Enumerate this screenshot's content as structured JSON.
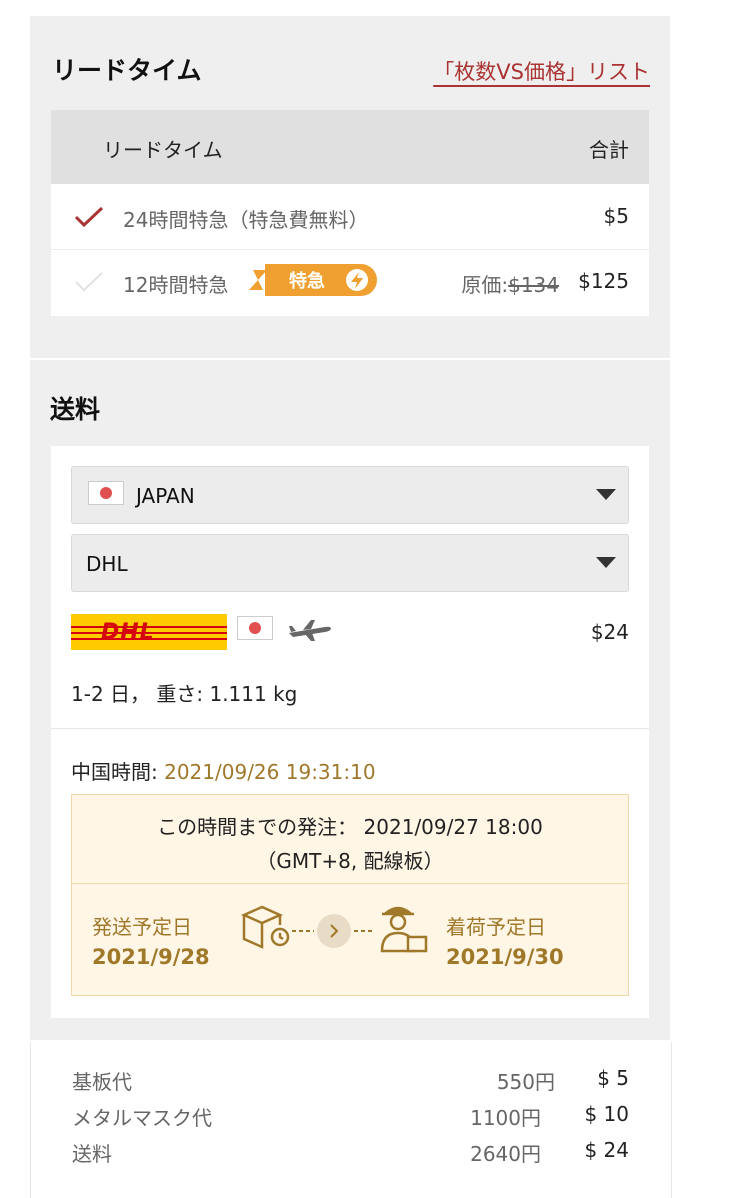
{
  "leadtime": {
    "title": "リードタイム",
    "list_link": "「枚数VS価格」リスト",
    "header_col1": "リードタイム",
    "header_col2": "合計",
    "options": [
      {
        "name": "24時間特急（特急費無料）",
        "price": "$5",
        "selected": true
      },
      {
        "name": "12時間特急",
        "badge": "特急",
        "orig_label": "原価:",
        "orig_price": "$134",
        "price": "$125",
        "selected": false
      }
    ]
  },
  "shipping": {
    "title": "送料",
    "country_select": "JAPAN",
    "carrier_select": "DHL",
    "carrier_logo_text": "DHL",
    "carrier_price": "$24",
    "delivery_info": "1-2 日， 重さ: 1.111 kg",
    "china_time_label": "中国時間: ",
    "china_time_value": "2021/09/26 19:31:10",
    "order_deadline": "この時間までの発注： 2021/09/27 18:00",
    "order_deadline_note": "（GMT+8,  配線板）",
    "ship_label": "発送予定日",
    "ship_date": "2021/9/28",
    "arrival_label": "着荷予定日",
    "arrival_date": "2021/9/30"
  },
  "costs": [
    {
      "label": "基板代",
      "yen": "550円",
      "usd": "$ 5"
    },
    {
      "label": "メタルマスク代",
      "yen": "1100円",
      "usd": "$ 10"
    },
    {
      "label": "送料",
      "yen": "2640円",
      "usd": "$ 24"
    }
  ],
  "colors": {
    "accent_red": "#a33",
    "gold": "#a0782a",
    "badge_orange": "#f0a030",
    "panel_bg": "#efefef"
  }
}
